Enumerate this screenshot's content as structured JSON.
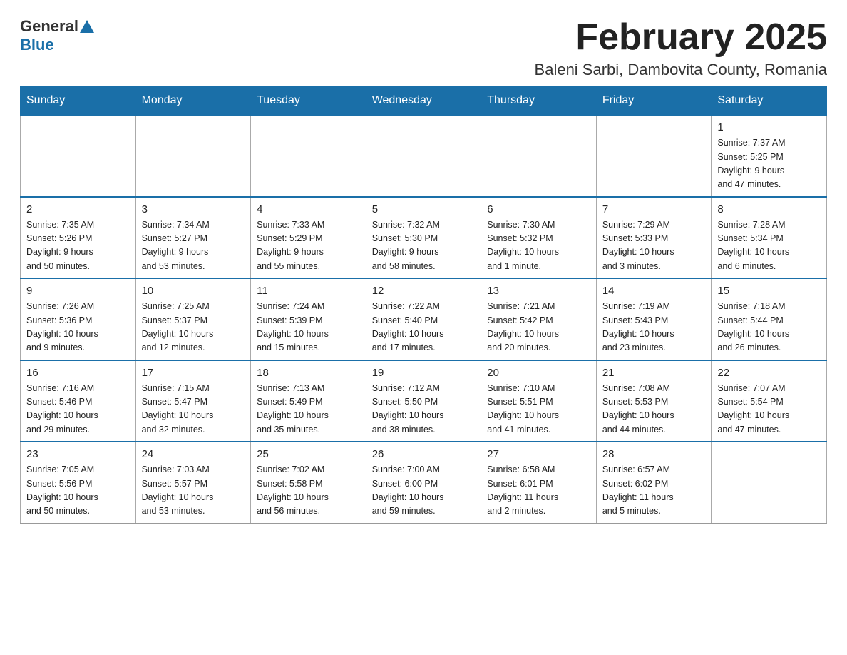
{
  "header": {
    "logo_general": "General",
    "logo_blue": "Blue",
    "title": "February 2025",
    "subtitle": "Baleni Sarbi, Dambovita County, Romania"
  },
  "weekdays": [
    "Sunday",
    "Monday",
    "Tuesday",
    "Wednesday",
    "Thursday",
    "Friday",
    "Saturday"
  ],
  "weeks": [
    [
      {
        "day": "",
        "info": ""
      },
      {
        "day": "",
        "info": ""
      },
      {
        "day": "",
        "info": ""
      },
      {
        "day": "",
        "info": ""
      },
      {
        "day": "",
        "info": ""
      },
      {
        "day": "",
        "info": ""
      },
      {
        "day": "1",
        "info": "Sunrise: 7:37 AM\nSunset: 5:25 PM\nDaylight: 9 hours\nand 47 minutes."
      }
    ],
    [
      {
        "day": "2",
        "info": "Sunrise: 7:35 AM\nSunset: 5:26 PM\nDaylight: 9 hours\nand 50 minutes."
      },
      {
        "day": "3",
        "info": "Sunrise: 7:34 AM\nSunset: 5:27 PM\nDaylight: 9 hours\nand 53 minutes."
      },
      {
        "day": "4",
        "info": "Sunrise: 7:33 AM\nSunset: 5:29 PM\nDaylight: 9 hours\nand 55 minutes."
      },
      {
        "day": "5",
        "info": "Sunrise: 7:32 AM\nSunset: 5:30 PM\nDaylight: 9 hours\nand 58 minutes."
      },
      {
        "day": "6",
        "info": "Sunrise: 7:30 AM\nSunset: 5:32 PM\nDaylight: 10 hours\nand 1 minute."
      },
      {
        "day": "7",
        "info": "Sunrise: 7:29 AM\nSunset: 5:33 PM\nDaylight: 10 hours\nand 3 minutes."
      },
      {
        "day": "8",
        "info": "Sunrise: 7:28 AM\nSunset: 5:34 PM\nDaylight: 10 hours\nand 6 minutes."
      }
    ],
    [
      {
        "day": "9",
        "info": "Sunrise: 7:26 AM\nSunset: 5:36 PM\nDaylight: 10 hours\nand 9 minutes."
      },
      {
        "day": "10",
        "info": "Sunrise: 7:25 AM\nSunset: 5:37 PM\nDaylight: 10 hours\nand 12 minutes."
      },
      {
        "day": "11",
        "info": "Sunrise: 7:24 AM\nSunset: 5:39 PM\nDaylight: 10 hours\nand 15 minutes."
      },
      {
        "day": "12",
        "info": "Sunrise: 7:22 AM\nSunset: 5:40 PM\nDaylight: 10 hours\nand 17 minutes."
      },
      {
        "day": "13",
        "info": "Sunrise: 7:21 AM\nSunset: 5:42 PM\nDaylight: 10 hours\nand 20 minutes."
      },
      {
        "day": "14",
        "info": "Sunrise: 7:19 AM\nSunset: 5:43 PM\nDaylight: 10 hours\nand 23 minutes."
      },
      {
        "day": "15",
        "info": "Sunrise: 7:18 AM\nSunset: 5:44 PM\nDaylight: 10 hours\nand 26 minutes."
      }
    ],
    [
      {
        "day": "16",
        "info": "Sunrise: 7:16 AM\nSunset: 5:46 PM\nDaylight: 10 hours\nand 29 minutes."
      },
      {
        "day": "17",
        "info": "Sunrise: 7:15 AM\nSunset: 5:47 PM\nDaylight: 10 hours\nand 32 minutes."
      },
      {
        "day": "18",
        "info": "Sunrise: 7:13 AM\nSunset: 5:49 PM\nDaylight: 10 hours\nand 35 minutes."
      },
      {
        "day": "19",
        "info": "Sunrise: 7:12 AM\nSunset: 5:50 PM\nDaylight: 10 hours\nand 38 minutes."
      },
      {
        "day": "20",
        "info": "Sunrise: 7:10 AM\nSunset: 5:51 PM\nDaylight: 10 hours\nand 41 minutes."
      },
      {
        "day": "21",
        "info": "Sunrise: 7:08 AM\nSunset: 5:53 PM\nDaylight: 10 hours\nand 44 minutes."
      },
      {
        "day": "22",
        "info": "Sunrise: 7:07 AM\nSunset: 5:54 PM\nDaylight: 10 hours\nand 47 minutes."
      }
    ],
    [
      {
        "day": "23",
        "info": "Sunrise: 7:05 AM\nSunset: 5:56 PM\nDaylight: 10 hours\nand 50 minutes."
      },
      {
        "day": "24",
        "info": "Sunrise: 7:03 AM\nSunset: 5:57 PM\nDaylight: 10 hours\nand 53 minutes."
      },
      {
        "day": "25",
        "info": "Sunrise: 7:02 AM\nSunset: 5:58 PM\nDaylight: 10 hours\nand 56 minutes."
      },
      {
        "day": "26",
        "info": "Sunrise: 7:00 AM\nSunset: 6:00 PM\nDaylight: 10 hours\nand 59 minutes."
      },
      {
        "day": "27",
        "info": "Sunrise: 6:58 AM\nSunset: 6:01 PM\nDaylight: 11 hours\nand 2 minutes."
      },
      {
        "day": "28",
        "info": "Sunrise: 6:57 AM\nSunset: 6:02 PM\nDaylight: 11 hours\nand 5 minutes."
      },
      {
        "day": "",
        "info": ""
      }
    ]
  ]
}
